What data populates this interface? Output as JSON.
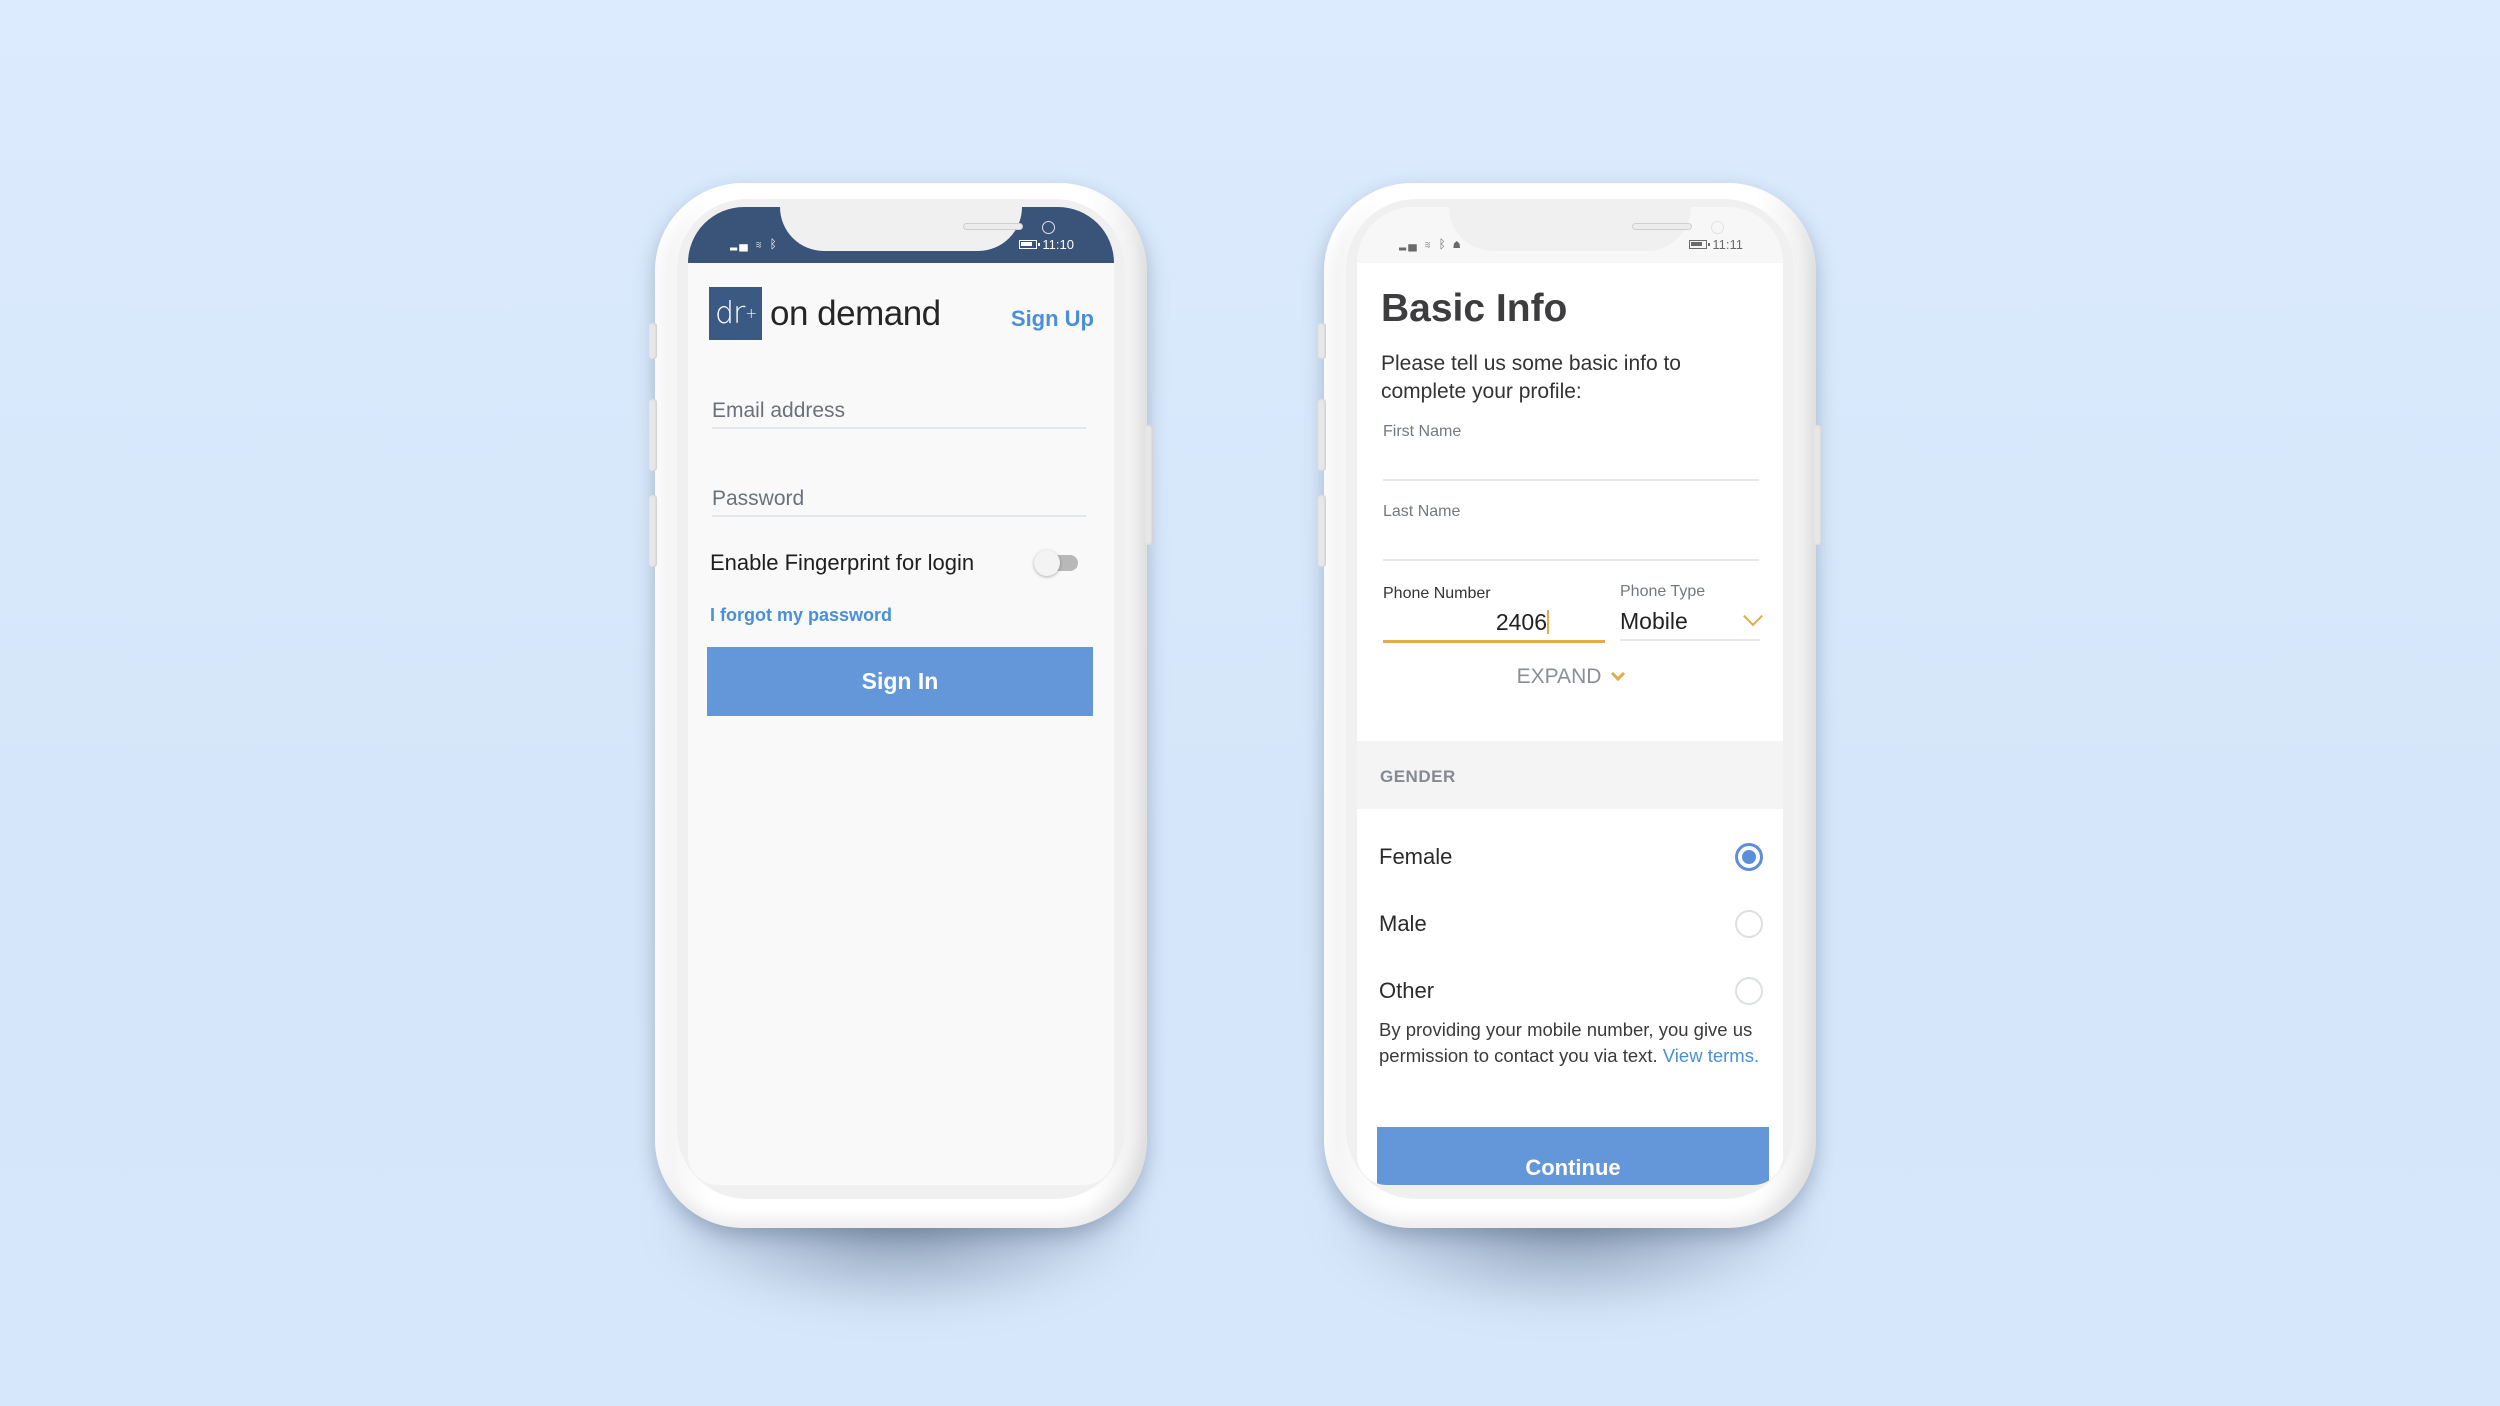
{
  "colors": {
    "background": "#dcebfd",
    "brand_navy": "#3a5378",
    "accent_blue": "#6497da",
    "link_blue": "#4a8fd8",
    "focus_gold": "#e2ac4a"
  },
  "login_screen": {
    "status_bar": {
      "left_icons": [
        "signal-icon",
        "wifi-icon",
        "bluetooth-icon"
      ],
      "time": "11:10"
    },
    "logo": {
      "mark": "dr",
      "mark_suffix": "+",
      "text": "on demand"
    },
    "sign_up_label": "Sign Up",
    "email_field": {
      "placeholder": "Email address",
      "value": ""
    },
    "password_field": {
      "placeholder": "Password",
      "value": ""
    },
    "fingerprint": {
      "label": "Enable Fingerprint for login",
      "enabled": false
    },
    "forgot_password_label": "I forgot my password",
    "sign_in_label": "Sign In"
  },
  "basic_info_screen": {
    "status_bar": {
      "left_icons": [
        "signal-icon",
        "wifi-icon",
        "bluetooth-icon",
        "vpn-icon"
      ],
      "time": "11:11"
    },
    "title": "Basic Info",
    "subtitle": "Please tell us some basic info to complete your profile:",
    "first_name": {
      "label": "First Name",
      "value": ""
    },
    "last_name": {
      "label": "Last Name",
      "value": ""
    },
    "phone_number": {
      "label": "Phone Number",
      "value": "2406"
    },
    "phone_type": {
      "label": "Phone Type",
      "selected": "Mobile"
    },
    "expand_label": "EXPAND",
    "gender": {
      "header": "GENDER",
      "options": [
        {
          "label": "Female",
          "selected": true
        },
        {
          "label": "Male",
          "selected": false
        },
        {
          "label": "Other",
          "selected": false
        }
      ]
    },
    "consent": {
      "text": "By providing your mobile number, you give us permission to contact you via text.",
      "link_label": "View terms."
    },
    "continue_label": "Continue"
  }
}
